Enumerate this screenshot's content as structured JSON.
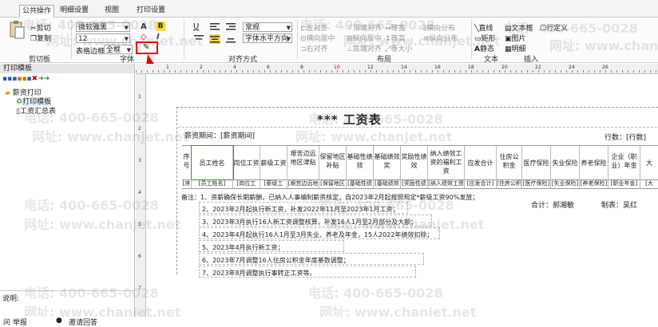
{
  "tabs": [
    "公共操作",
    "明细设置",
    "视图",
    "打印设置"
  ],
  "ribbon": {
    "clipboard": {
      "cut": "剪切",
      "copy": "复制",
      "group": "剪切板"
    },
    "font": {
      "family": "微软雅黑",
      "size": "12",
      "border_label": "表格边框",
      "border_value": "全框",
      "group": "字体"
    },
    "align": {
      "style": "常规",
      "dir": "字体水平方向",
      "group": "对齐方式"
    },
    "layout": {
      "items": [
        "左对齐",
        "横向居中",
        "右对齐",
        "顶端对齐",
        "纵向居中",
        "底端对齐",
        "等宽",
        "等高",
        "等大小",
        "横向分布",
        "纵向分布"
      ],
      "group": "布局"
    },
    "text": {
      "items": [
        "直线",
        "矩形",
        "静态"
      ],
      "group": "文本"
    },
    "insert": {
      "items": [
        "文本框",
        "图片",
        "明细",
        "行定义"
      ],
      "group": "插入"
    }
  },
  "left": {
    "title": "打印模板",
    "tree": {
      "root": "薪资打印",
      "child1": "打印模板",
      "child2": "工资汇总表"
    },
    "remark": "说明:"
  },
  "report": {
    "title": "*** 工资表",
    "period": "薪资期间：[薪资期间]",
    "rows": "行数：[行数]",
    "headers": [
      "序号",
      "员工姓名",
      "岗位工资",
      "薪级工资",
      "艰苦边远地区津贴",
      "保留地区补贴",
      "基础性绩效",
      "基础绩效奖",
      "奖励性绩效",
      "纳入绩效工资的福利工资",
      "应发合计",
      "住房公积金",
      "医疗保险",
      "失业保险",
      "养老保险",
      "企业（职业）年金",
      "大"
    ],
    "fields": [
      "[序号]",
      "[员工姓名]",
      "[岗位工资]",
      "[薪级工资]",
      "[艰苦边远地区津贴]",
      "[保留地区补贴]",
      "[基础性绩效]",
      "[基础绩效奖]",
      "[奖励性绩效]",
      "[纳入绩效工资的福利]",
      "[应发合计]",
      "[住房公积金]",
      "[医疗保险]",
      "[失业保险]",
      "[养老保险]",
      "[职业年金]",
      "[大"
    ],
    "notes": [
      "备注：1、资薪确保长期薪酬，已纳入人事编制薪资核定，自2023年2月起按照规定*薪级工资90%发放；",
      "2、2023年2月起执行新工资，补发2022年11月至2023年1月工资；",
      "3、2023年3月执行16人新工资调整核算，补发16人1月至2月部分及大额；",
      "4、2023年4月起执行16人1月至3月失业、养老及年金，15人2022年绩效扣除；",
      "5、2023年4月执行新工资；",
      "6、2023年7月调整16人住房公积金年度基数调整；",
      "7、2023年8月调整执行事转正工资等。"
    ],
    "total": "合计：郝湘敏",
    "maker": "制表：吴红"
  },
  "watermarks": [
    "电话: 400-665-0028",
    "网址: www.chanjet.net"
  ],
  "status": {
    "a": "问 举报",
    "b": "邀请回答"
  },
  "colors": {
    "highlight_red": "#e60000",
    "ribbon_bg": "#fbfbfb",
    "ruler": "#f0f0f0"
  }
}
